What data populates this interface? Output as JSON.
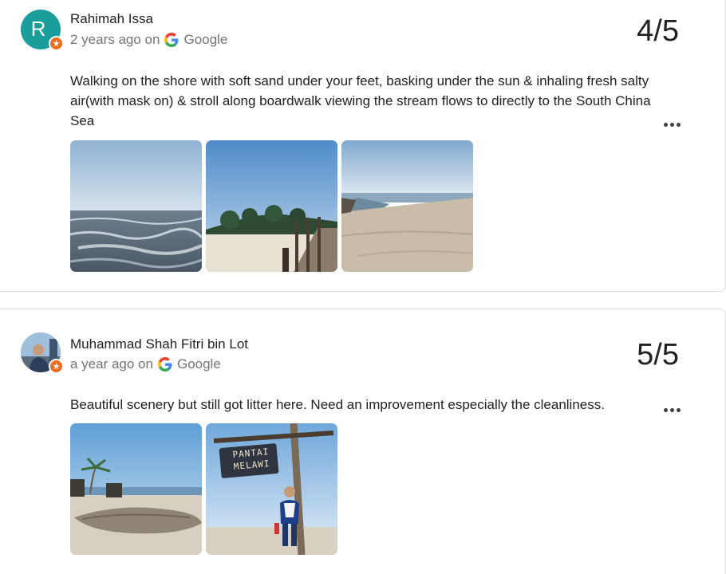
{
  "reviews": [
    {
      "author": "Rahimah Issa",
      "avatar_letter": "R",
      "time_ago": "2 years ago on",
      "source": "Google",
      "rating": "4/5",
      "text": "Walking on the shore with soft sand under your feet, basking under the sun & inhaling fresh salty air(with mask on) & stroll along boardwalk viewing the stream flows to directly to the South China Sea",
      "photos": [
        "beach-waves-photo",
        "boardwalk-photo",
        "sand-shore-photo"
      ]
    },
    {
      "author": "Muhammad Shah Fitri bin Lot",
      "time_ago": "a year ago on",
      "source": "Google",
      "rating": "5/5",
      "text": "Beautiful scenery but still got litter here. Need an improvement especially the cleanliness.",
      "photos": [
        "driftwood-beach-photo",
        "pantai-melawi-sign-photo"
      ],
      "sign_text_line1": "PANTAI",
      "sign_text_line2": "MELAWI"
    }
  ],
  "colors": {
    "avatar_teal": "#1a9e9c",
    "badge_orange": "#f26a1b",
    "meta_gray": "#70757a"
  },
  "icons": {
    "more": "more-horiz-icon",
    "google": "google-g-icon",
    "badge": "local-guide-badge-icon"
  }
}
